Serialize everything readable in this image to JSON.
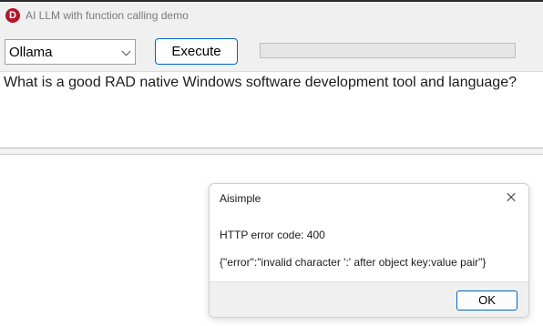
{
  "window": {
    "title": "AI LLM with function calling demo",
    "icon_letter": "D",
    "icon_color": "#b3152b"
  },
  "toolbar": {
    "provider_selected": "Ollama",
    "execute_label": "Execute",
    "progress_percent": 0
  },
  "prompt": {
    "text": "What is a good RAD native Windows software development tool and language?"
  },
  "dialog": {
    "title": "Aisimple",
    "message_line1": "HTTP error code: 400",
    "message_line2": "{\"error\":\"invalid character ':' after object key:value pair\"}",
    "ok_label": "OK"
  },
  "colors": {
    "accent": "#0067c0",
    "window_bg": "#f0f0f0"
  }
}
